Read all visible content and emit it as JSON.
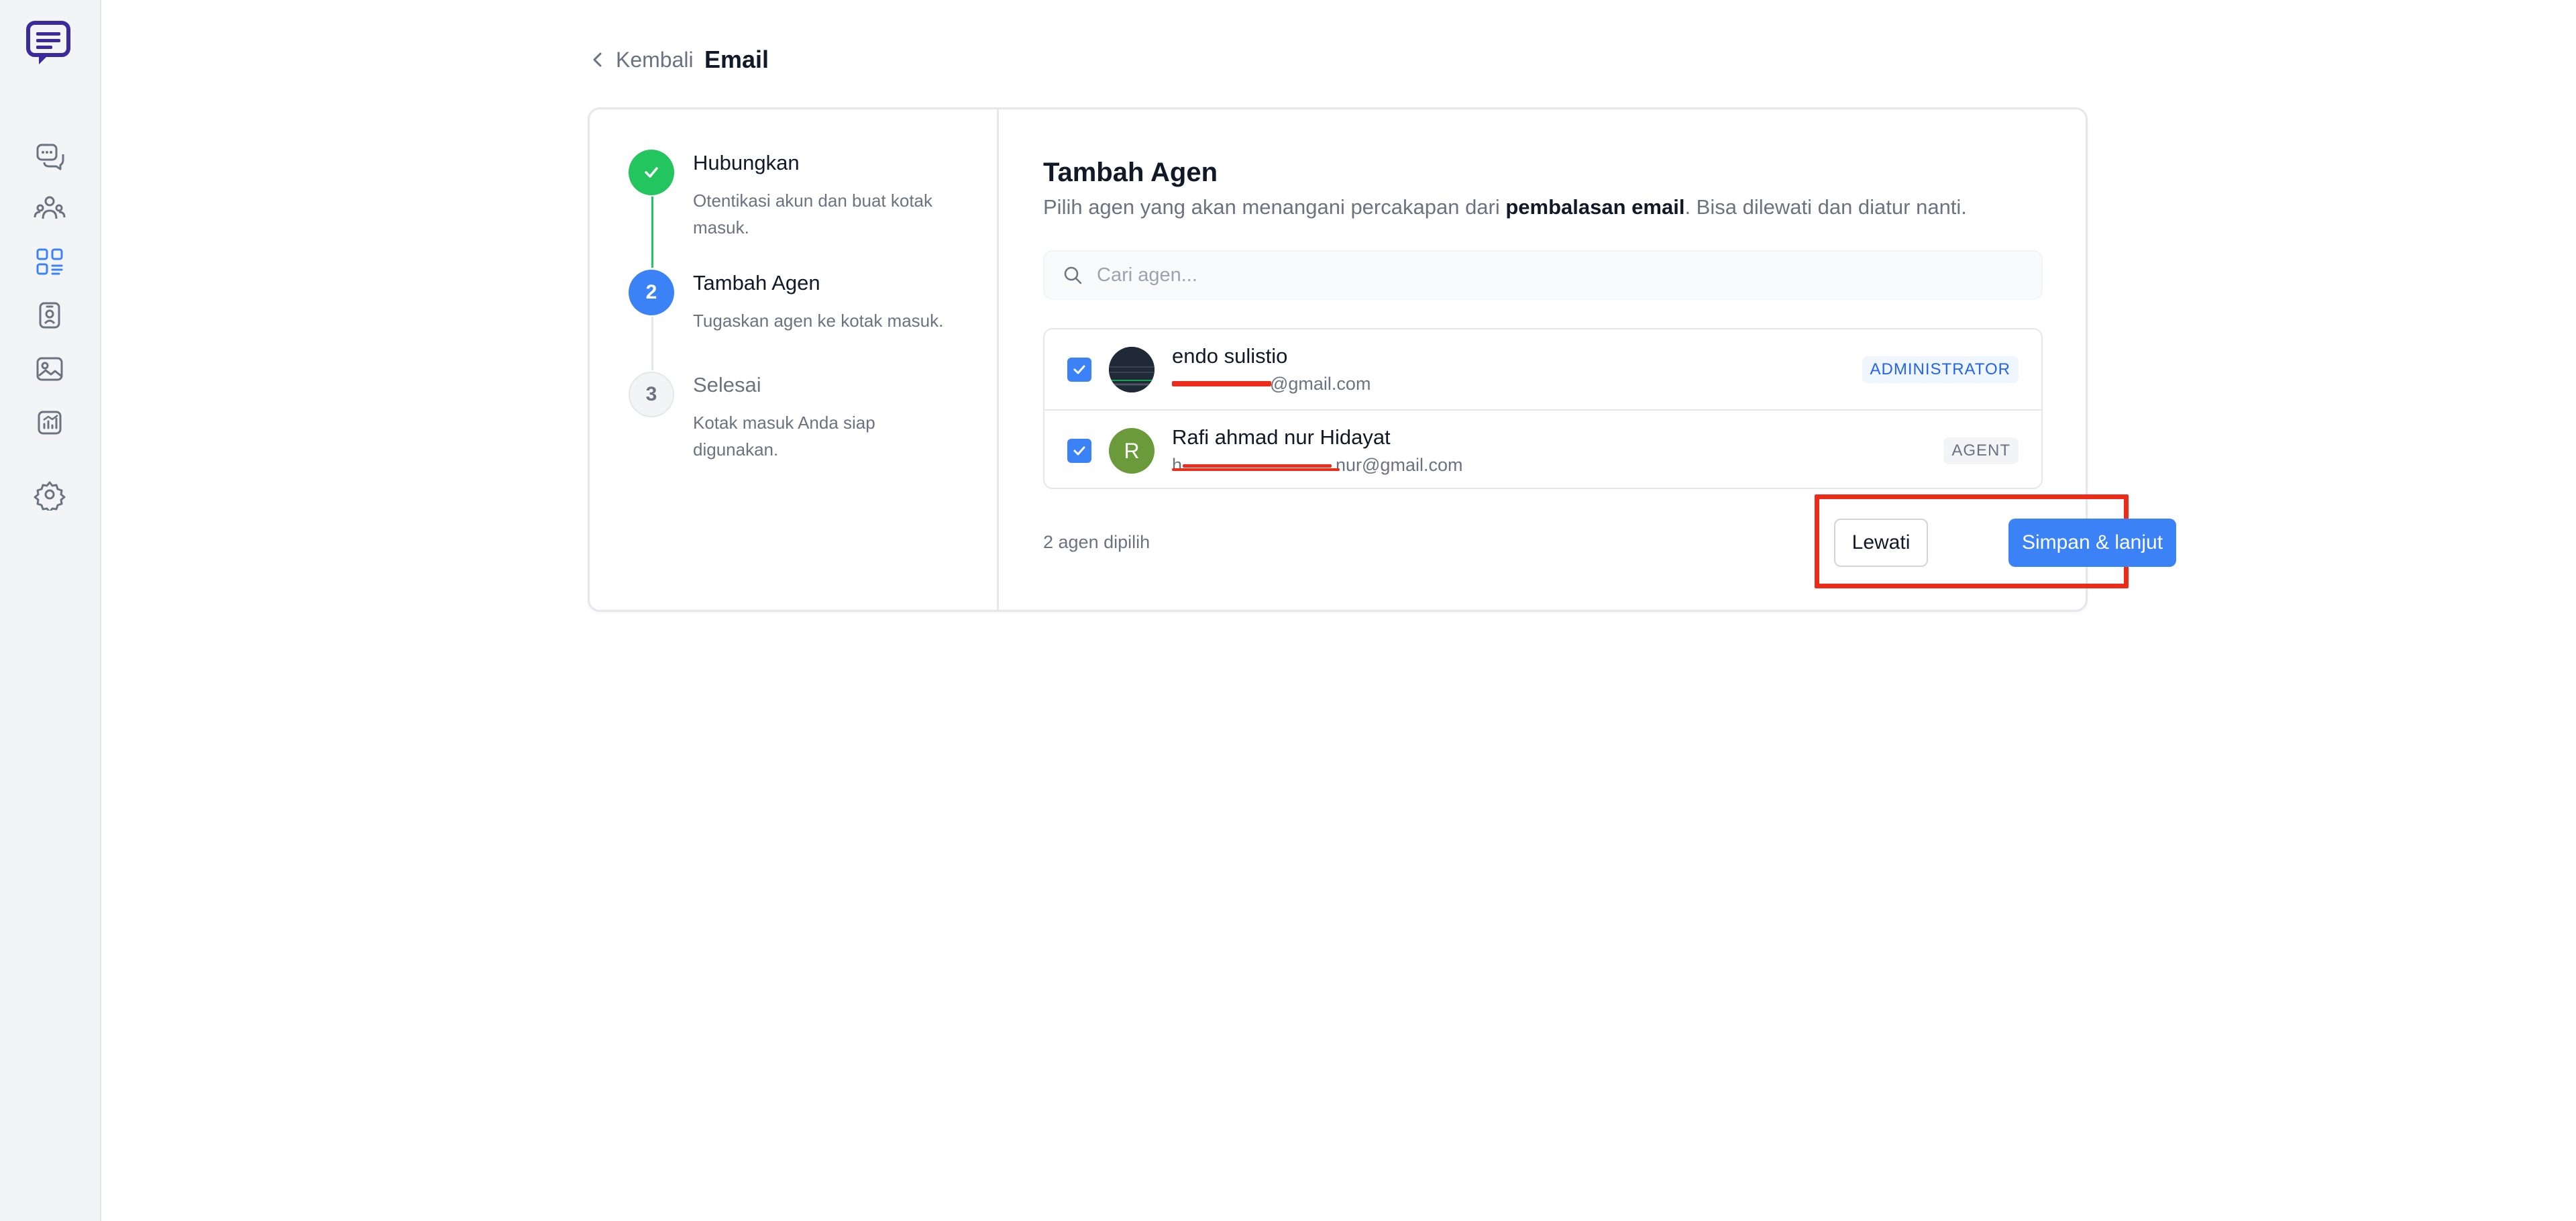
{
  "colors": {
    "accent": "#3b82f6",
    "success": "#22c55e",
    "highlight": "#ee2a19",
    "sidebar_bg": "#f3f4f6",
    "logo": "#3b2a9e"
  },
  "sidebar": {
    "items": [
      {
        "icon": "chat-bubbles-icon"
      },
      {
        "icon": "contacts-icon"
      },
      {
        "icon": "dashboard-grid-icon",
        "active": true
      },
      {
        "icon": "contact-card-icon"
      },
      {
        "icon": "image-gallery-icon"
      },
      {
        "icon": "reports-chart-icon"
      },
      {
        "icon": "settings-gear-icon"
      }
    ]
  },
  "header": {
    "back_label": "Kembali",
    "title": "Email"
  },
  "steps": [
    {
      "number": "1",
      "title": "Hubungkan",
      "description": "Otentikasi akun dan buat kotak masuk.",
      "status": "done"
    },
    {
      "number": "2",
      "title": "Tambah Agen",
      "description": "Tugaskan agen ke kotak masuk.",
      "status": "active"
    },
    {
      "number": "3",
      "title": "Selesai",
      "description": "Kotak masuk Anda siap digunakan.",
      "status": "pending"
    }
  ],
  "main": {
    "title": "Tambah Agen",
    "description_prefix": "Pilih agen yang akan menangani percakapan dari ",
    "description_bold": "pembalasan email",
    "description_suffix": ". Bisa dilewati dan diatur nanti.",
    "search_placeholder": "Cari agen...",
    "agents": [
      {
        "name": "endo sulistio",
        "email": "@gmail.com",
        "role": "ADMINISTRATOR",
        "checked": true,
        "avatar": "photo"
      },
      {
        "name": "Rafi ahmad nur Hidayat",
        "email_start": "h",
        "email_end": "nur@gmail.com",
        "avatar_letter": "R",
        "role": "AGENT",
        "checked": true
      }
    ],
    "selected_count": "2 agen dipilih",
    "skip_label": "Lewati",
    "save_label": "Simpan & lanjut"
  }
}
